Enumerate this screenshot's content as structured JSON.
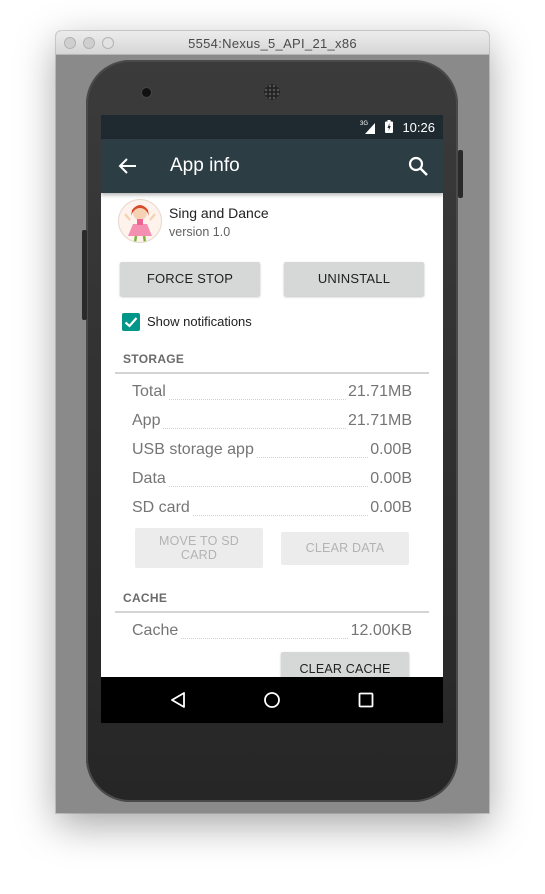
{
  "window": {
    "title": "5554:Nexus_5_API_21_x86"
  },
  "status_bar": {
    "time": "10:26",
    "network": "3G"
  },
  "app_bar": {
    "title": "App info"
  },
  "app": {
    "name": "Sing and Dance",
    "version": "version 1.0"
  },
  "actions": {
    "force_stop": "FORCE STOP",
    "uninstall": "UNINSTALL"
  },
  "notifications": {
    "label": "Show notifications",
    "checked": true
  },
  "storage": {
    "header": "STORAGE",
    "rows": [
      {
        "label": "Total",
        "value": "21.71MB"
      },
      {
        "label": "App",
        "value": "21.71MB"
      },
      {
        "label": "USB storage app",
        "value": "0.00B"
      },
      {
        "label": "Data",
        "value": "0.00B"
      },
      {
        "label": "SD card",
        "value": "0.00B"
      }
    ],
    "move_to_sd_line1": "MOVE TO SD",
    "move_to_sd_line2": "CARD",
    "clear_data": "CLEAR DATA"
  },
  "cache": {
    "header": "CACHE",
    "rows": [
      {
        "label": "Cache",
        "value": "12.00KB"
      }
    ],
    "clear_cache": "CLEAR CACHE"
  },
  "colors": {
    "status_bar": "#1f2a30",
    "app_bar": "#2d3d44",
    "accent": "#009688",
    "button": "#d6d7d7"
  },
  "icons": [
    "back-arrow-icon",
    "search-icon",
    "signal-icon",
    "battery-icon",
    "nav-back-icon",
    "nav-home-icon",
    "nav-recents-icon"
  ]
}
